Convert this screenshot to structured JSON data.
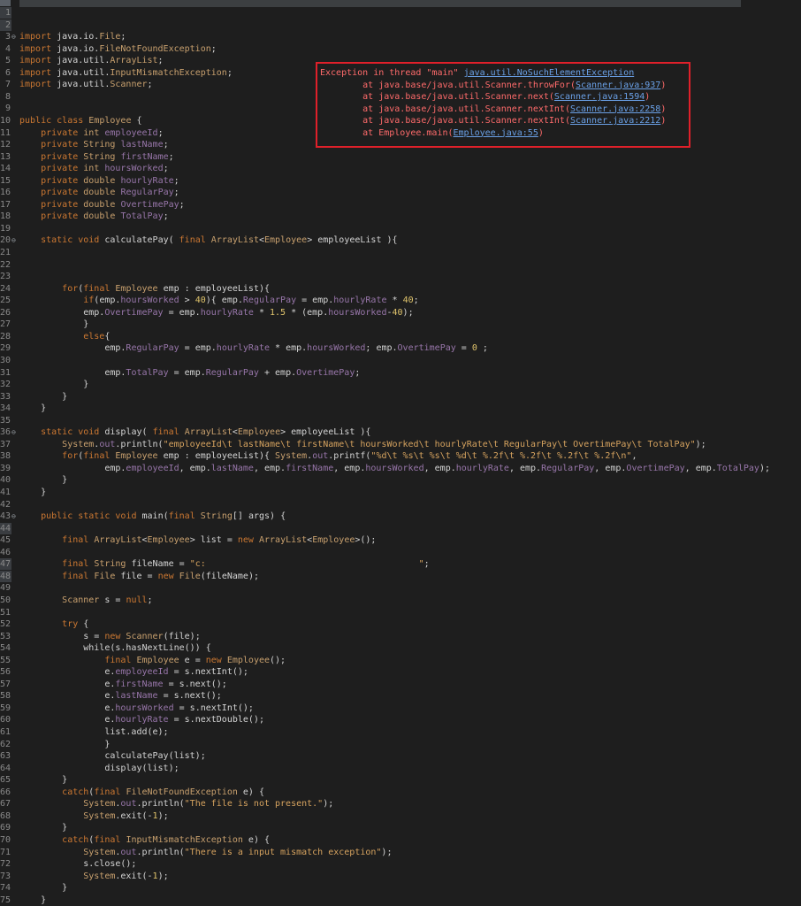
{
  "editor": {
    "lines": [
      {
        "n": "1",
        "fold": "",
        "hl": true,
        "code": ""
      },
      {
        "n": "2",
        "fold": "",
        "hl": true,
        "code": ""
      },
      {
        "n": "3",
        "fold": "⊖",
        "code": "import java.io.File;"
      },
      {
        "n": "4",
        "code": "import java.io.FileNotFoundException;"
      },
      {
        "n": "5",
        "code": "import java.util.ArrayList;"
      },
      {
        "n": "6",
        "code": "import java.util.InputMismatchException;"
      },
      {
        "n": "7",
        "code": "import java.util.Scanner;"
      },
      {
        "n": "8",
        "code": ""
      },
      {
        "n": "9",
        "code": ""
      },
      {
        "n": "10",
        "code": "public class Employee {"
      },
      {
        "n": "11",
        "code": "    private int employeeId;"
      },
      {
        "n": "12",
        "code": "    private String lastName;"
      },
      {
        "n": "13",
        "code": "    private String firstName;"
      },
      {
        "n": "14",
        "code": "    private int hoursWorked;"
      },
      {
        "n": "15",
        "code": "    private double hourlyRate;"
      },
      {
        "n": "16",
        "code": "    private double RegularPay;"
      },
      {
        "n": "17",
        "code": "    private double OvertimePay;"
      },
      {
        "n": "18",
        "code": "    private double TotalPay;"
      },
      {
        "n": "19",
        "code": ""
      },
      {
        "n": "20",
        "fold": "⊖",
        "code": "    static void calculatePay( final ArrayList<Employee> employeeList ){"
      },
      {
        "n": "21",
        "code": ""
      },
      {
        "n": "22",
        "code": ""
      },
      {
        "n": "23",
        "code": ""
      },
      {
        "n": "24",
        "code": "        for(final Employee emp : employeeList){"
      },
      {
        "n": "25",
        "code": "            if(emp.hoursWorked > 40){ emp.RegularPay = emp.hourlyRate * 40;"
      },
      {
        "n": "26",
        "code": "            emp.OvertimePay = emp.hourlyRate * 1.5 * (emp.hoursWorked-40);"
      },
      {
        "n": "27",
        "code": "            }"
      },
      {
        "n": "28",
        "code": "            else{"
      },
      {
        "n": "29",
        "code": "                emp.RegularPay = emp.hourlyRate * emp.hoursWorked; emp.OvertimePay = 0 ;"
      },
      {
        "n": "30",
        "code": ""
      },
      {
        "n": "31",
        "code": "                emp.TotalPay = emp.RegularPay + emp.OvertimePay;"
      },
      {
        "n": "32",
        "code": "            }"
      },
      {
        "n": "33",
        "code": "        }"
      },
      {
        "n": "34",
        "code": "    }"
      },
      {
        "n": "35",
        "code": ""
      },
      {
        "n": "36",
        "fold": "⊖",
        "code": "    static void display( final ArrayList<Employee> employeeList ){"
      },
      {
        "n": "37",
        "code": "        System.out.println(\"employeeId\\t lastName\\t firstName\\t hoursWorked\\t hourlyRate\\t RegularPay\\t OvertimePay\\t TotalPay\");"
      },
      {
        "n": "38",
        "code": "        for(final Employee emp : employeeList){ System.out.printf(\"%d\\t %s\\t %s\\t %d\\t %.2f\\t %.2f\\t %.2f\\t %.2f\\n\","
      },
      {
        "n": "39",
        "code": "                emp.employeeId, emp.lastName, emp.firstName, emp.hoursWorked, emp.hourlyRate, emp.RegularPay, emp.OvertimePay, emp.TotalPay);"
      },
      {
        "n": "40",
        "code": "        }"
      },
      {
        "n": "41",
        "code": "    }"
      },
      {
        "n": "42",
        "code": ""
      },
      {
        "n": "43",
        "fold": "⊖",
        "code": "    public static void main(final String[] args) {"
      },
      {
        "n": "44",
        "hl": true,
        "code": ""
      },
      {
        "n": "45",
        "code": "        final ArrayList<Employee> list = new ArrayList<Employee>();"
      },
      {
        "n": "46",
        "code": ""
      },
      {
        "n": "47",
        "hl": true,
        "code": "        final String fileName = \"c:                                        \";"
      },
      {
        "n": "48",
        "hl": true,
        "code": "        final File file = new File(fileName);"
      },
      {
        "n": "49",
        "code": ""
      },
      {
        "n": "50",
        "code": "        Scanner s = null;"
      },
      {
        "n": "51",
        "code": ""
      },
      {
        "n": "52",
        "code": "        try {"
      },
      {
        "n": "53",
        "code": "            s = new Scanner(file);"
      },
      {
        "n": "54",
        "code": "            while(s.hasNextLine()) {"
      },
      {
        "n": "55",
        "code": "                final Employee e = new Employee();"
      },
      {
        "n": "56",
        "code": "                e.employeeId = s.nextInt();"
      },
      {
        "n": "57",
        "code": "                e.firstName = s.next();"
      },
      {
        "n": "58",
        "code": "                e.lastName = s.next();"
      },
      {
        "n": "59",
        "code": "                e.hoursWorked = s.nextInt();"
      },
      {
        "n": "60",
        "code": "                e.hourlyRate = s.nextDouble();"
      },
      {
        "n": "61",
        "code": "                list.add(e);"
      },
      {
        "n": "62",
        "code": "                }"
      },
      {
        "n": "63",
        "code": "                calculatePay(list);"
      },
      {
        "n": "64",
        "code": "                display(list);"
      },
      {
        "n": "65",
        "code": "        }"
      },
      {
        "n": "66",
        "code": "        catch(final FileNotFoundException e) {"
      },
      {
        "n": "67",
        "code": "            System.out.println(\"The file is not present.\");"
      },
      {
        "n": "68",
        "code": "            System.exit(-1);"
      },
      {
        "n": "69",
        "code": "        }"
      },
      {
        "n": "70",
        "code": "        catch(final InputMismatchException e) {"
      },
      {
        "n": "71",
        "code": "            System.out.println(\"There is a input mismatch exception\");"
      },
      {
        "n": "72",
        "code": "            s.close();"
      },
      {
        "n": "73",
        "code": "            System.exit(-1);"
      },
      {
        "n": "74",
        "code": "        }"
      },
      {
        "n": "75",
        "code": "    }"
      }
    ]
  },
  "console": {
    "header_prefix": "Exception in thread \"main\" ",
    "header_link": "java.util.NoSuchElementException",
    "frames": [
      {
        "text": "        at java.base/java.util.Scanner.throwFor(",
        "link": "Scanner.java:937",
        "suffix": ")"
      },
      {
        "text": "        at java.base/java.util.Scanner.next(",
        "link": "Scanner.java:1594",
        "suffix": ")"
      },
      {
        "text": "        at java.base/java.util.Scanner.nextInt(",
        "link": "Scanner.java:2258",
        "suffix": ")"
      },
      {
        "text": "        at java.base/java.util.Scanner.nextInt(",
        "link": "Scanner.java:2212",
        "suffix": ")"
      },
      {
        "text": "        at Employee.main(",
        "link": "Employee.java:55",
        "suffix": ")"
      }
    ]
  },
  "colors": {
    "background": "#1e1e1e",
    "error_border": "#e0202a",
    "error_text": "#ff6b6b",
    "link": "#6aa0e6"
  }
}
